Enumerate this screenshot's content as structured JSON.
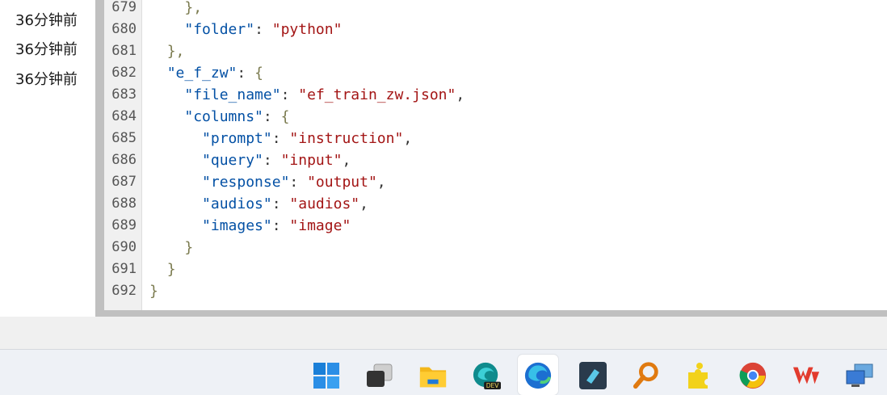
{
  "timestamps": [
    "36分钟前",
    "36分钟前",
    "36分钟前"
  ],
  "editor": {
    "lines": [
      {
        "n": "679",
        "indent": "    ",
        "tokens": [
          {
            "t": "},",
            "c": "b"
          }
        ]
      },
      {
        "n": "680",
        "indent": "    ",
        "tokens": [
          {
            "t": "\"folder\"",
            "c": "k"
          },
          {
            "t": ": ",
            "c": "p"
          },
          {
            "t": "\"python\"",
            "c": "s"
          }
        ]
      },
      {
        "n": "681",
        "indent": "  ",
        "tokens": [
          {
            "t": "},",
            "c": "b"
          }
        ]
      },
      {
        "n": "682",
        "indent": "  ",
        "tokens": [
          {
            "t": "\"e_f_zw\"",
            "c": "k"
          },
          {
            "t": ": ",
            "c": "p"
          },
          {
            "t": "{",
            "c": "b"
          }
        ]
      },
      {
        "n": "683",
        "indent": "    ",
        "tokens": [
          {
            "t": "\"file_name\"",
            "c": "k"
          },
          {
            "t": ": ",
            "c": "p"
          },
          {
            "t": "\"ef_train_zw.json\"",
            "c": "s"
          },
          {
            "t": ",",
            "c": "p"
          }
        ]
      },
      {
        "n": "684",
        "indent": "    ",
        "tokens": [
          {
            "t": "\"columns\"",
            "c": "k"
          },
          {
            "t": ": ",
            "c": "p"
          },
          {
            "t": "{",
            "c": "b"
          }
        ]
      },
      {
        "n": "685",
        "indent": "      ",
        "tokens": [
          {
            "t": "\"prompt\"",
            "c": "k"
          },
          {
            "t": ": ",
            "c": "p"
          },
          {
            "t": "\"instruction\"",
            "c": "s"
          },
          {
            "t": ",",
            "c": "p"
          }
        ]
      },
      {
        "n": "686",
        "indent": "      ",
        "tokens": [
          {
            "t": "\"query\"",
            "c": "k"
          },
          {
            "t": ": ",
            "c": "p"
          },
          {
            "t": "\"input\"",
            "c": "s"
          },
          {
            "t": ",",
            "c": "p"
          }
        ]
      },
      {
        "n": "687",
        "indent": "      ",
        "tokens": [
          {
            "t": "\"response\"",
            "c": "k"
          },
          {
            "t": ": ",
            "c": "p"
          },
          {
            "t": "\"output\"",
            "c": "s"
          },
          {
            "t": ",",
            "c": "p"
          }
        ]
      },
      {
        "n": "688",
        "indent": "      ",
        "tokens": [
          {
            "t": "\"audios\"",
            "c": "k"
          },
          {
            "t": ": ",
            "c": "p"
          },
          {
            "t": "\"audios\"",
            "c": "s"
          },
          {
            "t": ",",
            "c": "p"
          }
        ]
      },
      {
        "n": "689",
        "indent": "      ",
        "tokens": [
          {
            "t": "\"images\"",
            "c": "k"
          },
          {
            "t": ": ",
            "c": "p"
          },
          {
            "t": "\"image\"",
            "c": "s"
          }
        ]
      },
      {
        "n": "690",
        "indent": "    ",
        "tokens": [
          {
            "t": "}",
            "c": "b"
          }
        ]
      },
      {
        "n": "691",
        "indent": "  ",
        "tokens": [
          {
            "t": "}",
            "c": "b"
          }
        ]
      },
      {
        "n": "692",
        "indent": "",
        "tokens": [
          {
            "t": "}",
            "c": "b"
          }
        ]
      }
    ]
  },
  "taskbar": {
    "icons": [
      "windows-start-icon",
      "task-view-icon",
      "file-explorer-icon",
      "edge-dev-icon",
      "edge-icon",
      "vscode-like-icon",
      "search-magnifier-icon",
      "puzzle-app-icon",
      "chrome-icon",
      "wps-icon",
      "remote-desktop-icon"
    ],
    "active": "edge-icon",
    "dev_badge": "DEV"
  }
}
